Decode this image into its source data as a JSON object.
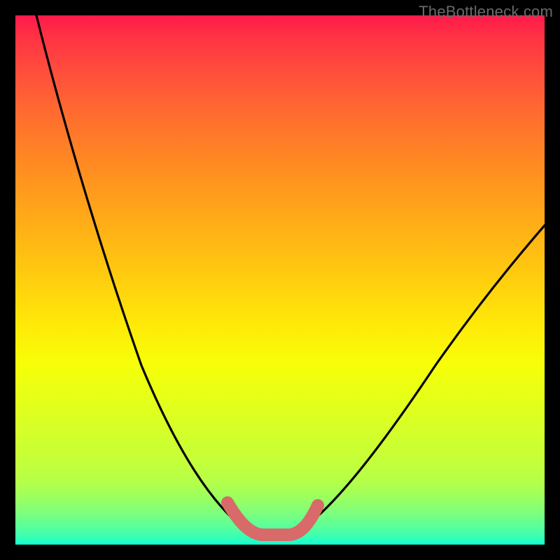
{
  "watermark": "TheBottleneck.com",
  "chart_data": {
    "type": "line",
    "title": "",
    "xlabel": "",
    "ylabel": "",
    "xlim": [
      0,
      100
    ],
    "ylim": [
      0,
      100
    ],
    "series": [
      {
        "name": "left-curve",
        "x": [
          4,
          6,
          8,
          10,
          12,
          14,
          16,
          18,
          20,
          22,
          24,
          26,
          28,
          30,
          32,
          34,
          36,
          38,
          40,
          41,
          43,
          44,
          46,
          50
        ],
        "y": [
          100,
          93,
          86,
          79,
          72,
          66,
          60,
          54,
          48,
          43,
          38,
          33,
          29,
          25,
          21,
          17,
          14,
          11,
          8,
          6,
          4.5,
          3.5,
          2.5,
          2
        ]
      },
      {
        "name": "right-curve",
        "x": [
          50,
          53,
          55,
          57,
          59,
          61,
          63,
          66,
          69,
          72,
          75,
          78,
          81,
          84,
          87,
          90,
          93,
          96,
          99,
          100
        ],
        "y": [
          2,
          2.5,
          3.5,
          5,
          7,
          9,
          11,
          14,
          18,
          22,
          26,
          30,
          34,
          38,
          42,
          46,
          50,
          54,
          58,
          60
        ]
      },
      {
        "name": "valley-highlight",
        "x": [
          40,
          41,
          42,
          43,
          44,
          45,
          46,
          47,
          48,
          49,
          50,
          51,
          52,
          53,
          54,
          55,
          56
        ],
        "y": [
          8,
          6,
          4.5,
          3.5,
          2.8,
          2.3,
          2.1,
          2,
          2,
          2,
          2,
          2,
          2.2,
          2.6,
          3.3,
          4.3,
          5.7
        ]
      }
    ],
    "colors": {
      "curve": "#000000",
      "highlight": "#d86a6a",
      "gradient_top": "#ff1a4a",
      "gradient_bottom": "#10ffd5"
    }
  }
}
